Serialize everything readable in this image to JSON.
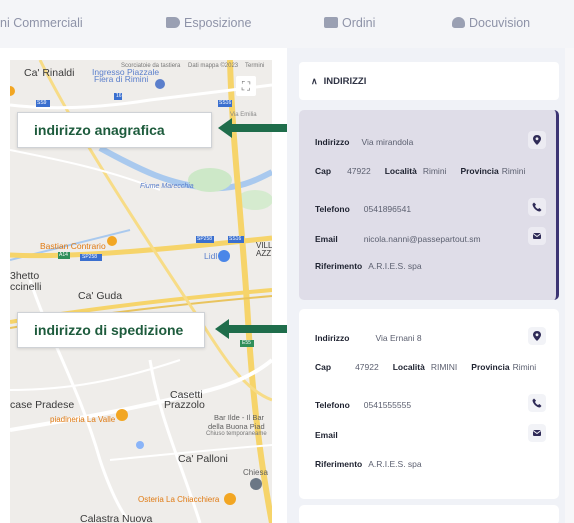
{
  "tabs": [
    {
      "label": "ni Commerciali",
      "icon": "none"
    },
    {
      "label": "Esposizione",
      "icon": "tag-icon"
    },
    {
      "label": "Ordini",
      "icon": "order-edit-icon"
    },
    {
      "label": "Docuvision",
      "icon": "cloud-upload-icon"
    }
  ],
  "map": {
    "attribution_1": "Scorciatoie da tastiera",
    "attribution_2": "Dati mappa ©2023",
    "attribution_3": "Termini",
    "places": {
      "ca_rinaldi": "Ca' Rinaldi",
      "ingresso": "Ingresso Piazzale",
      "fiera": "Fiera di Rimini",
      "fiume": "Fiume Marecchia",
      "bastian": "Bastian Contrario",
      "lidl": "Lidl",
      "villa": "VILL",
      "azz": "AZZ",
      "ghetto": "3hetto",
      "ccinelli": "ccinelli",
      "ca_guda": "Ca' Guda",
      "casetti": "Casetti",
      "prazzolo": "Prazzolo",
      "case_pradese": "case Pradese",
      "piadineria": "piadineria La Valle",
      "bar_ilde_1": "Bar Ilde - Il Bar",
      "bar_ilde_2": "della Buona Piad",
      "bar_ilde_3": "Chiuso temporaneame",
      "ca_palloni": "Ca' Palloni",
      "chiesa": "Chiesa",
      "osteria": "Osteria La Chiacchiera",
      "calastra": "Calastra Nuova",
      "road_ss9": "SS9",
      "road_sp258": "SP258",
      "road_a14": "A14",
      "road_e55": "E55",
      "via_emilia": "Via Emilia",
      "road_ss16": "SS16",
      "road_16": "16"
    }
  },
  "callouts": {
    "anagrafica": "indirizzo anagrafica",
    "spedizione": "indirizzo di spedizione"
  },
  "section": {
    "title": "INDIRIZZI"
  },
  "address_1": {
    "indirizzo_label": "Indirizzo",
    "indirizzo": "Via mirandola",
    "cap_label": "Cap",
    "cap": "47922",
    "localita_label": "Località",
    "localita": "Rimini",
    "provincia_label": "Provincia",
    "provincia": "Rimini",
    "telefono_label": "Telefono",
    "telefono": "0541896541",
    "email_label": "Email",
    "email": "nicola.nanni@passepartout.sm",
    "riferimento_label": "Riferimento",
    "riferimento": "A.R.I.E.S. spa"
  },
  "address_2": {
    "indirizzo_label": "Indirizzo",
    "indirizzo": "Via Ernani 8",
    "cap_label": "Cap",
    "cap": "47922",
    "localita_label": "Località",
    "localita": "RIMINI",
    "provincia_label": "Provincia",
    "provincia": "Rimini",
    "telefono_label": "Telefono",
    "telefono": "0541555555",
    "email_label": "Email",
    "email": "",
    "riferimento_label": "Riferimento",
    "riferimento": "A.R.I.E.S. spa"
  }
}
